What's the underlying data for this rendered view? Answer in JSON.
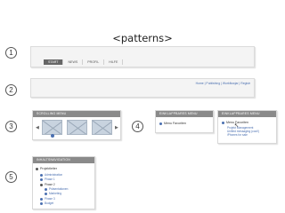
{
  "page": {
    "title": "<patterns>"
  },
  "steps": [
    "1",
    "2",
    "3",
    "4",
    "5"
  ],
  "row1": {
    "tabs": [
      {
        "label": "START",
        "active": true
      },
      {
        "label": "NEWS",
        "active": false
      },
      {
        "label": "PROFIL",
        "active": false
      },
      {
        "label": "HILFE",
        "active": false
      }
    ]
  },
  "row2": {
    "links": "Home | Publishing | Workflowjar | Registr"
  },
  "row3": {
    "scrolling_menu": {
      "title": "SCROLLING MENU"
    }
  },
  "row4": {
    "collapsed": {
      "title": "EINKLAPPBARES MENU",
      "item": "Menu Favoriten"
    },
    "expanded": {
      "title": "EINKLAPPBARES MENU",
      "item": "Menu Favoriten",
      "subitems": [
        "Projekt Management",
        "Unified messaging (cool!)",
        "iPhones for sale"
      ]
    }
  },
  "row5": {
    "title": "INHALTSNAVIGATION",
    "top": "Projektleiter",
    "items": [
      {
        "label": "Administration",
        "level": 1
      },
      {
        "label": "Phase 1",
        "level": 1
      },
      {
        "label": "Phase 2",
        "level": 1
      },
      {
        "label": "Präsentationen",
        "level": 2
      },
      {
        "label": "Marketing",
        "level": 2
      },
      {
        "label": "Phase 3",
        "level": 1
      },
      {
        "label": "Budget",
        "level": 1
      }
    ]
  },
  "colors": {
    "accent": "#4a6fb0",
    "header": "#8a8a8a",
    "panel": "#f4f4f4"
  }
}
